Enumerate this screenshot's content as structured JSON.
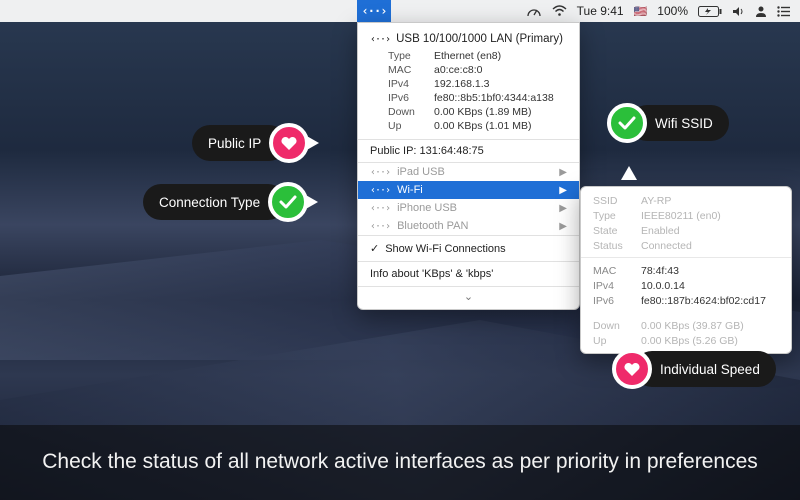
{
  "menubar": {
    "app_icon_glyph": "‹··›",
    "clock": "Tue 9:41",
    "battery": "100%",
    "flag_glyph": "🇺🇸"
  },
  "primary_interface": {
    "title": "USB 10/100/1000 LAN (Primary)",
    "glyph": "‹··›",
    "rows": [
      {
        "k": "Type",
        "v": "Ethernet (en8)"
      },
      {
        "k": "MAC",
        "v": "a0:ce:c8:0"
      },
      {
        "k": "IPv4",
        "v": "192.168.1.3"
      },
      {
        "k": "IPv6",
        "v": "fe80::8b5:1bf0:4344:a138"
      },
      {
        "k": "Down",
        "v": "0.00 KBps (1.89 MB)"
      },
      {
        "k": "Up",
        "v": "0.00 KBps (1.01 MB)"
      }
    ]
  },
  "public_ip": {
    "label": "Public IP: 131:64:48:75"
  },
  "interfaces": [
    {
      "glyph": "‹··›",
      "label": "iPad USB",
      "dim": true
    },
    {
      "glyph": "‹··›",
      "label": "Wi-Fi",
      "selected": true
    },
    {
      "glyph": "‹··›",
      "label": "iPhone USB",
      "dim": true
    },
    {
      "glyph": "‹··›",
      "label": "Bluetooth PAN",
      "dim": true
    }
  ],
  "options": {
    "show_wifi": "Show Wi-Fi Connections",
    "info": "Info about 'KBps' & 'kbps'",
    "expand_glyph": "⌄"
  },
  "wifi_detail": {
    "top": [
      {
        "k": "SSID",
        "v": "AY-RP"
      },
      {
        "k": "Type",
        "v": "IEEE80211 (en0)"
      },
      {
        "k": "State",
        "v": "Enabled"
      },
      {
        "k": "Status",
        "v": "Connected"
      }
    ],
    "mid": [
      {
        "k": "MAC",
        "v": "78:4f:43"
      },
      {
        "k": "IPv4",
        "v": "10.0.0.14"
      },
      {
        "k": "IPv6",
        "v": "fe80::187b:4624:bf02:cd17"
      }
    ],
    "bot": [
      {
        "k": "Down",
        "v": "0.00 KBps (39.87 GB)"
      },
      {
        "k": "Up",
        "v": "0.00 KBps (5.26 GB)"
      }
    ]
  },
  "callouts": {
    "public_ip": "Public IP",
    "conn_type": "Connection Type",
    "wifi_ssid": "Wifi SSID",
    "indiv_speed": "Individual Speed"
  },
  "caption": "Check the status of all network active interfaces as per priority in preferences"
}
